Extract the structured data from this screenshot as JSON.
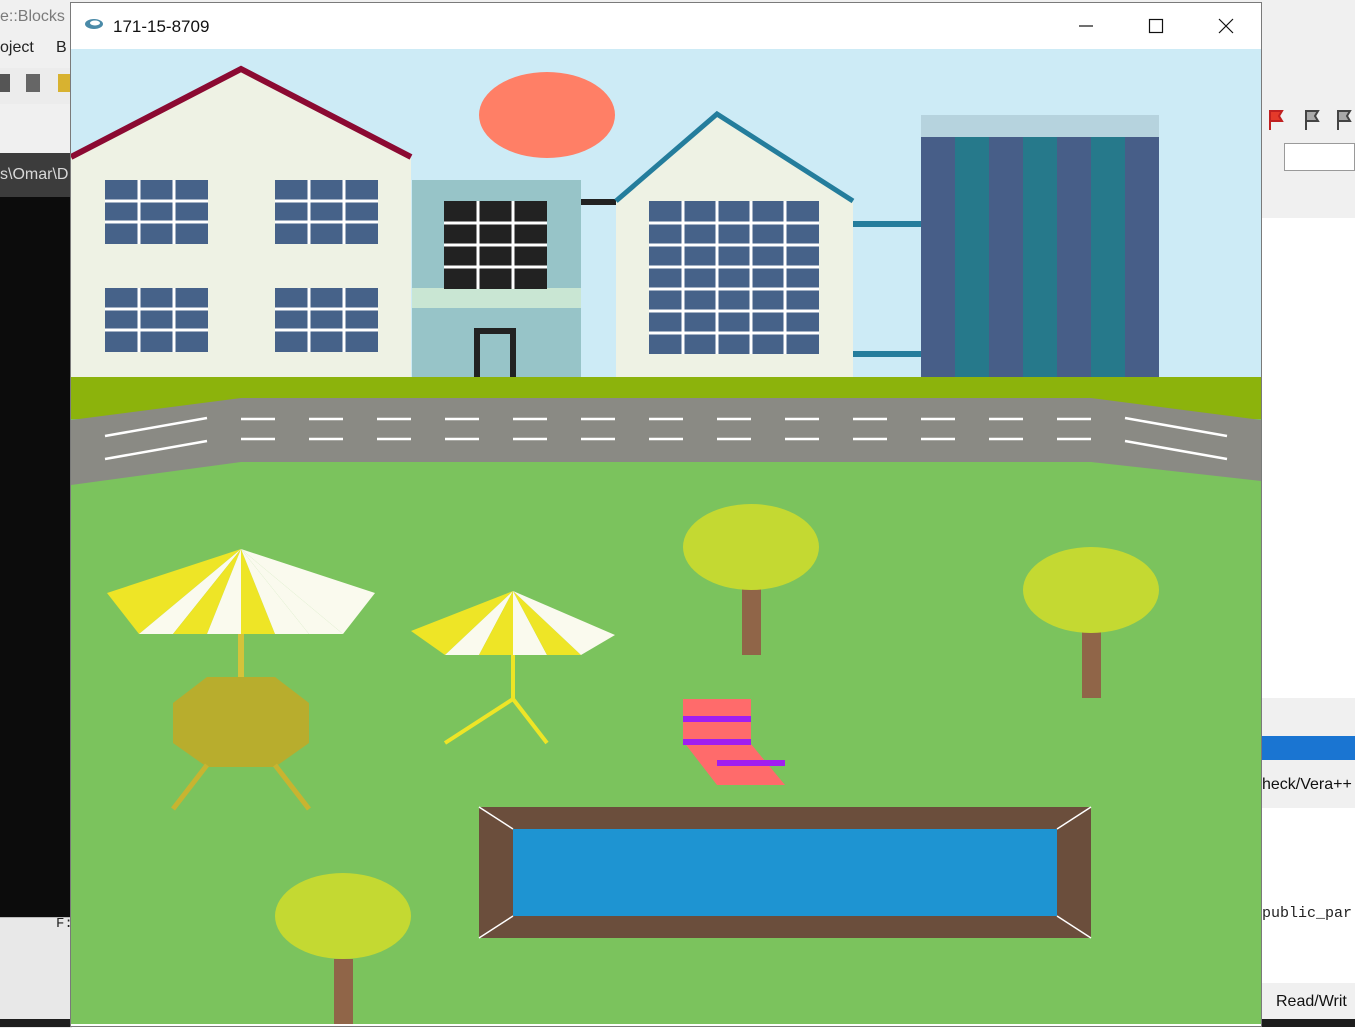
{
  "background_app": {
    "title_fragment": "e::Blocks",
    "menu_fragment_1": "oject",
    "menu_fragment_2": "B",
    "path_fragment": "s\\Omar\\D",
    "lower_panel_text": "F:",
    "right_tab": "heck/Vera++",
    "right_code": "public_par",
    "status_text": "Read/Writ"
  },
  "window": {
    "title": "171-15-8709",
    "controls": {
      "minimize": "minimize",
      "maximize": "maximize",
      "close": "close"
    }
  },
  "scene": {
    "sky_color": "#cdebf6",
    "sun_color": "#ff7f66",
    "grass_color": "#7bc35d",
    "verge_color": "#8cb30c",
    "road_color": "#8a8a84",
    "pool_water_color": "#1e94d2",
    "pool_frame_color": "#6b4e3c",
    "tree_foliage_color": "#c4d932",
    "tree_trunk_color": "#906548",
    "umbrella_yellow": "#eee526",
    "umbrella_white": "#fafaee",
    "table_color": "#b8ad2d",
    "chair_color": "#ff6b6b",
    "chair_slat_color": "#a11ef0",
    "building_wall_color": "#eef2e4",
    "window_color": "#466289",
    "roof_left_color": "#8b0a32",
    "roof_mid_color": "#247d9c",
    "tower_dark": "#475e88",
    "tower_teal": "#26798b"
  }
}
